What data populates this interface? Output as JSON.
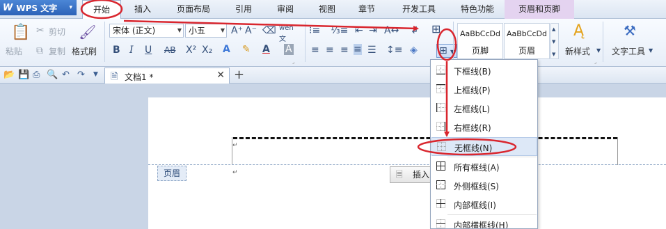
{
  "app": {
    "name": "WPS 文字",
    "logo": "W",
    "menu_arrow": "▾"
  },
  "menu": {
    "items": [
      "开始",
      "插入",
      "页面布局",
      "引用",
      "审阅",
      "视图",
      "章节",
      "开发工具",
      "特色功能",
      "页眉和页脚"
    ]
  },
  "ribbon": {
    "paste": "粘贴",
    "cut": "剪切",
    "copy": "复制",
    "format_painter": "格式刷",
    "font_name": "宋体 (正文)",
    "font_size": "小五",
    "styles": [
      {
        "sample": "AaBbCcDd",
        "caption": "页脚"
      },
      {
        "sample": "AaBbCcDd",
        "caption": "页眉"
      }
    ],
    "new_style": "新样式",
    "text_tools": "文字工具"
  },
  "doc": {
    "tab_title": "文档1 *",
    "header_label": "页眉",
    "insert_button": "插入",
    "para_mark": "↵"
  },
  "border_menu": {
    "items": [
      {
        "label": "下框线(B)",
        "icon": "bottom-border-icon"
      },
      {
        "label": "上框线(P)",
        "icon": "top-border-icon"
      },
      {
        "label": "左框线(L)",
        "icon": "left-border-icon"
      },
      {
        "label": "右框线(R)",
        "icon": "right-border-icon"
      },
      {
        "label": "无框线(N)",
        "icon": "no-border-icon"
      },
      {
        "label": "所有框线(A)",
        "icon": "all-borders-icon"
      },
      {
        "label": "外侧框线(S)",
        "icon": "outside-borders-icon"
      },
      {
        "label": "内部框线(I)",
        "icon": "inside-borders-icon"
      },
      {
        "label": "内部横框线(H)",
        "icon": "inside-horizontal-border-icon"
      }
    ]
  },
  "annotation_color": "#d9262e",
  "colors": {
    "font_color": "#d9262e",
    "highlight": "#f2d43b",
    "shading": "#7aa7e0"
  }
}
